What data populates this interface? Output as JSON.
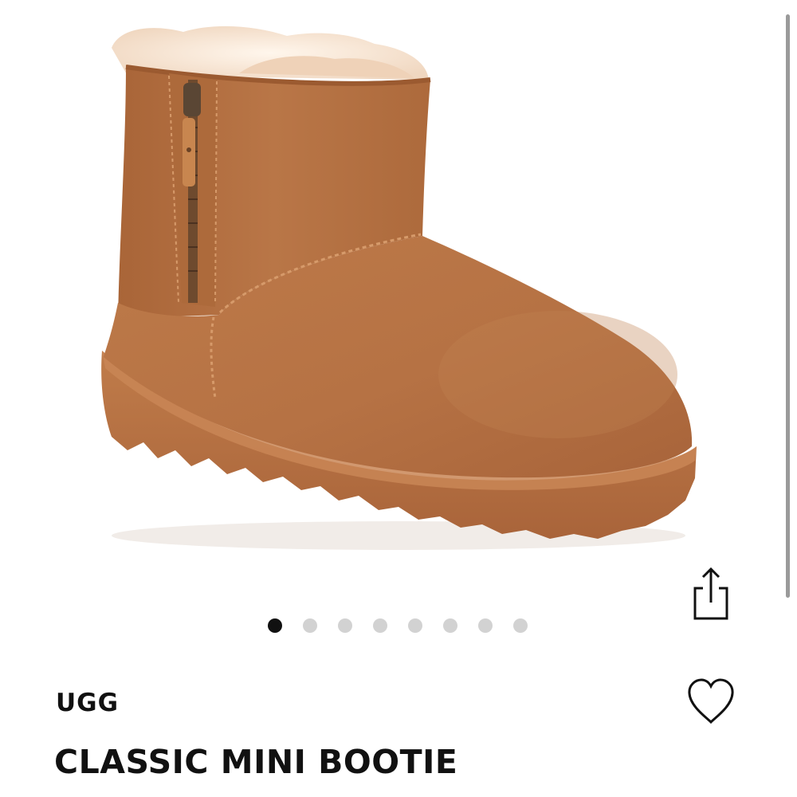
{
  "product": {
    "brand": "UGG",
    "name": "CLASSIC MINI BOOTIE",
    "image_subject": "chestnut-suede-mini-boot-with-side-zip"
  },
  "gallery": {
    "total_images": 8,
    "active_index": 0
  },
  "icons": {
    "share": "share-icon",
    "favorite": "heart-icon"
  },
  "colors": {
    "suede": "#b87545",
    "suede_dark": "#9c5c32",
    "sole": "#b66f40",
    "fur": "#f7e6d6",
    "dot_active": "#111111",
    "dot_inactive": "#d2d2d2",
    "text": "#111111"
  }
}
